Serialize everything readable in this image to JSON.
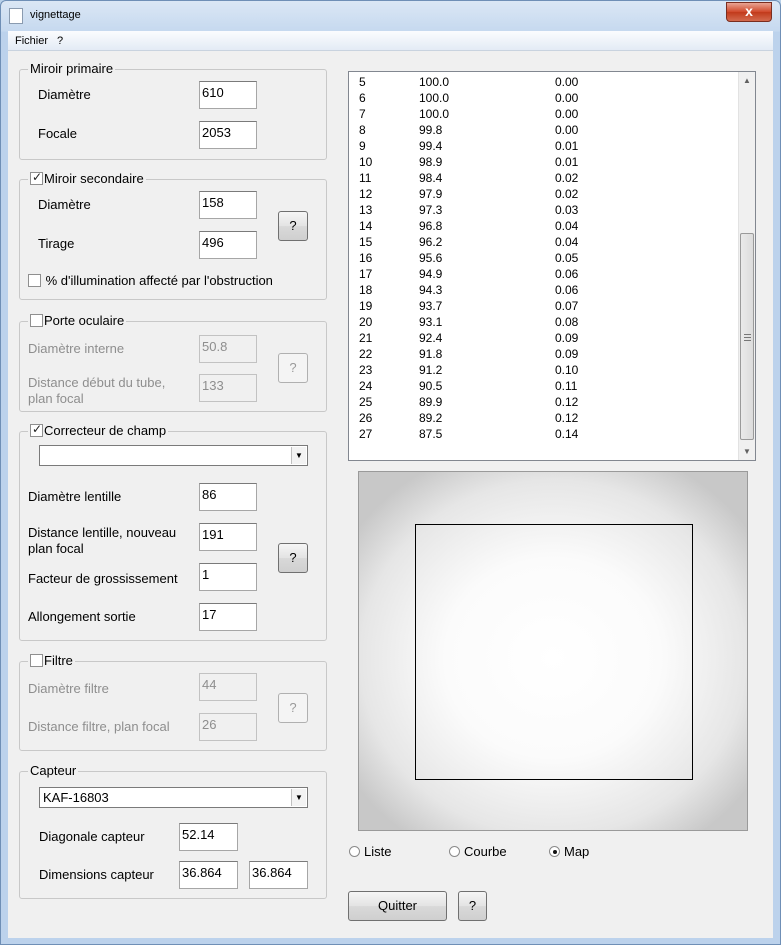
{
  "window": {
    "title": "vignettage",
    "close_label": "x"
  },
  "menu": {
    "items": [
      "Fichier",
      "?"
    ]
  },
  "miroir_primaire": {
    "title": "Miroir primaire",
    "diametre_label": "Diamètre",
    "diametre_value": "610",
    "focale_label": "Focale",
    "focale_value": "2053"
  },
  "miroir_secondaire": {
    "title": "Miroir secondaire",
    "checked": true,
    "diametre_label": "Diamètre",
    "diametre_value": "158",
    "tirage_label": "Tirage",
    "tirage_value": "496",
    "help_label": "?",
    "obstruction_label": "% d'illumination affecté par l'obstruction"
  },
  "porte_oculaire": {
    "title": "Porte oculaire",
    "checked": false,
    "diametre_label": "Diamètre interne",
    "diametre_value": "50.8",
    "distance_label_1": "Distance début du tube,",
    "distance_label_2": "plan focal",
    "distance_value": "133",
    "help_label": "?"
  },
  "correcteur": {
    "title": "Correcteur de champ",
    "checked": true,
    "combo_value": "",
    "lentille_label": "Diamètre lentille",
    "lentille_value": "86",
    "distance_label_1": "Distance lentille, nouveau",
    "distance_label_2": "plan focal",
    "distance_value": "191",
    "facteur_label": "Facteur de grossissement",
    "facteur_value": "1",
    "allongement_label": "Allongement sortie",
    "allongement_value": "17",
    "help_label": "?"
  },
  "filtre": {
    "title": "Filtre",
    "checked": false,
    "diametre_label": "Diamètre filtre",
    "diametre_value": "44",
    "distance_label": "Distance filtre, plan focal",
    "distance_value": "26",
    "help_label": "?"
  },
  "capteur": {
    "title": "Capteur",
    "combo_value": "KAF-16803",
    "diagonale_label": "Diagonale capteur",
    "diagonale_value": "52.14",
    "dimensions_label": "Dimensions capteur",
    "dim_w": "36.864",
    "dim_h": "36.864"
  },
  "list": {
    "rows": [
      [
        "5",
        "100.0",
        "0.00"
      ],
      [
        "6",
        "100.0",
        "0.00"
      ],
      [
        "7",
        "100.0",
        "0.00"
      ],
      [
        "8",
        "99.8",
        "0.00"
      ],
      [
        "9",
        "99.4",
        "0.01"
      ],
      [
        "10",
        "98.9",
        "0.01"
      ],
      [
        "11",
        "98.4",
        "0.02"
      ],
      [
        "12",
        "97.9",
        "0.02"
      ],
      [
        "13",
        "97.3",
        "0.03"
      ],
      [
        "14",
        "96.8",
        "0.04"
      ],
      [
        "15",
        "96.2",
        "0.04"
      ],
      [
        "16",
        "95.6",
        "0.05"
      ],
      [
        "17",
        "94.9",
        "0.06"
      ],
      [
        "18",
        "94.3",
        "0.06"
      ],
      [
        "19",
        "93.7",
        "0.07"
      ],
      [
        "20",
        "93.1",
        "0.08"
      ],
      [
        "21",
        "92.4",
        "0.09"
      ],
      [
        "22",
        "91.8",
        "0.09"
      ],
      [
        "23",
        "91.2",
        "0.10"
      ],
      [
        "24",
        "90.5",
        "0.11"
      ],
      [
        "25",
        "89.9",
        "0.12"
      ],
      [
        "26",
        "89.2",
        "0.12"
      ],
      [
        "27",
        "87.5",
        "0.14"
      ]
    ]
  },
  "view": {
    "liste_label": "Liste",
    "courbe_label": "Courbe",
    "map_label": "Map",
    "selected": "map"
  },
  "footer": {
    "quitter_label": "Quitter",
    "help_label": "?"
  }
}
